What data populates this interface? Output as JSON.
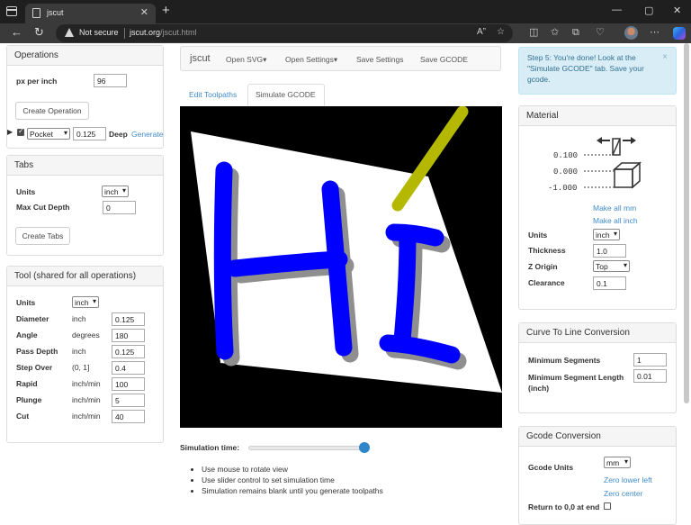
{
  "browser": {
    "tab_title": "jscut",
    "tab_close": "✕",
    "new_tab": "+",
    "win_min": "—",
    "win_max": "▢",
    "win_close": "✕",
    "security_label": "Not secure",
    "url_host": "jscut.org",
    "url_path": "/jscut.html"
  },
  "topnav": {
    "brand": "jscut",
    "items": [
      "Open SVG▾",
      "Open Settings▾",
      "Save Settings",
      "Save GCODE"
    ]
  },
  "view_tabs": [
    "Edit Toolpaths",
    "Simulate GCODE"
  ],
  "alert": {
    "text": "Step 5: You're done! Look at the \"Simulate GCODE\" tab. Save your gcode.",
    "close": "×"
  },
  "operations": {
    "title": "Operations",
    "px_per_inch_label": "px per inch",
    "px_per_inch_value": "96",
    "create_button": "Create Operation",
    "op_row": {
      "expand": "▶",
      "enabled": true,
      "type": "Pocket",
      "depth": "0.125",
      "deep_label": "Deep",
      "generate_label": "Generate"
    }
  },
  "tabs_panel": {
    "title": "Tabs",
    "units_label": "Units",
    "units_value": "inch",
    "max_cut_depth_label": "Max Cut Depth",
    "max_cut_depth_value": "0",
    "create_button": "Create Tabs"
  },
  "tool": {
    "title": "Tool (shared for all operations)",
    "units_label": "Units",
    "units_value": "inch",
    "rows": [
      {
        "label": "Diameter",
        "unit": "inch",
        "value": "0.125"
      },
      {
        "label": "Angle",
        "unit": "degrees",
        "value": "180"
      },
      {
        "label": "Pass Depth",
        "unit": "inch",
        "value": "0.125"
      },
      {
        "label": "Step Over",
        "unit": "(0, 1]",
        "value": "0.4"
      },
      {
        "label": "Rapid",
        "unit": "inch/min",
        "value": "100"
      },
      {
        "label": "Plunge",
        "unit": "inch/min",
        "value": "5"
      },
      {
        "label": "Cut",
        "unit": "inch/min",
        "value": "40"
      }
    ]
  },
  "simulation": {
    "time_label": "Simulation time:",
    "slider_fraction": 0.98,
    "notes": [
      "Use mouse to rotate view",
      "Use slider control to set simulation time",
      "Simulation remains blank until you generate toolpaths"
    ]
  },
  "material": {
    "title": "Material",
    "diagram_values": [
      "0.100",
      "0.000",
      "-1.000"
    ],
    "make_all_mm": "Make all mm",
    "make_all_inch": "Make all inch",
    "units_label": "Units",
    "units_value": "inch",
    "thickness_label": "Thickness",
    "thickness_value": "1.0",
    "z_origin_label": "Z Origin",
    "z_origin_value": "Top",
    "clearance_label": "Clearance",
    "clearance_value": "0.1"
  },
  "curve": {
    "title": "Curve To Line Conversion",
    "min_segments_label": "Minimum Segments",
    "min_segments_value": "1",
    "min_seg_length_label": "Minimum Segment Length (inch)",
    "min_seg_length_value": "0.01"
  },
  "gcode": {
    "title": "Gcode Conversion",
    "units_label": "Gcode Units",
    "units_value": "mm",
    "zero_lower_left": "Zero lower left",
    "zero_center": "Zero center",
    "return_label": "Return to 0,0 at end"
  },
  "colors": {
    "link": "#428bca",
    "letters": "#0000ff",
    "tool": "#b5b800",
    "slider": "#2f86c9",
    "alert_bg": "#d9edf7"
  }
}
